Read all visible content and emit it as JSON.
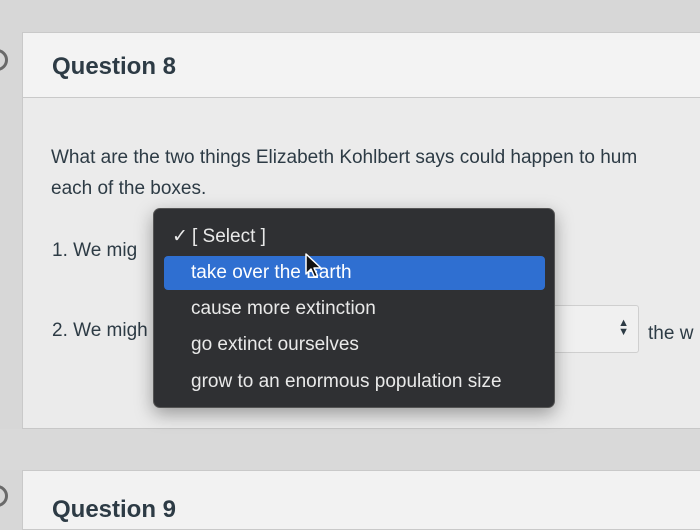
{
  "question8": {
    "title": "Question 8",
    "prompt_line1": "What are the two things Elizabeth Kohlbert says could happen to hum",
    "prompt_line2": "each of the boxes.",
    "item1_label": "1.  We mig",
    "item2_label": "2.  We migh",
    "item2_trailing": "the w"
  },
  "dropdown": {
    "check_mark": "✓",
    "options": [
      "[ Select ]",
      "take over the Earth",
      "cause more extinction",
      "go extinct ourselves",
      "grow to an enormous population size"
    ],
    "highlighted_index": 1,
    "checked_index": 0
  },
  "select2": {
    "arrows": "▲▼"
  },
  "question9": {
    "title": "Question 9"
  },
  "colors": {
    "highlight": "#2f6fd1",
    "menu_bg": "#2f3033",
    "text": "#2d3b45"
  }
}
